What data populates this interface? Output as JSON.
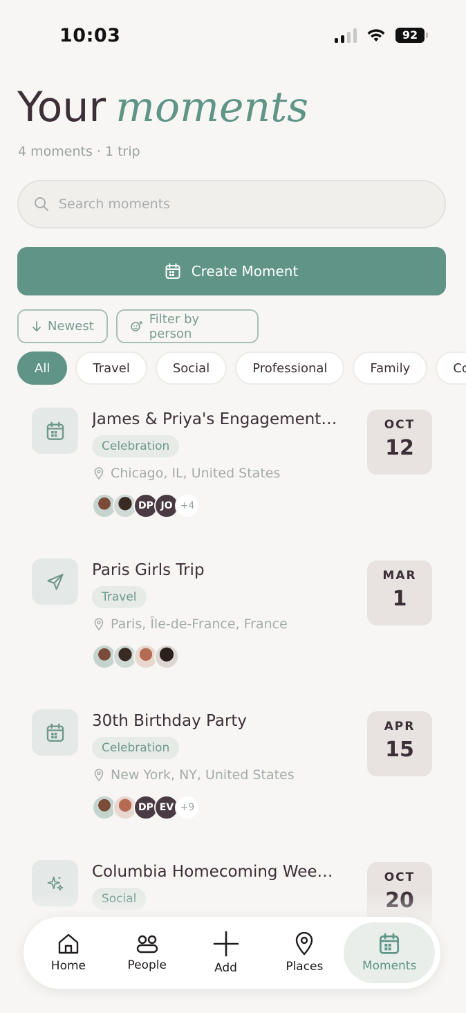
{
  "status_bar": {
    "time": "10:03",
    "battery": "92"
  },
  "header": {
    "title_plain": "Your",
    "title_accent": "moments",
    "subtitle": "4 moments · 1 trip"
  },
  "search": {
    "placeholder": "Search moments",
    "value": ""
  },
  "create_button": {
    "label": "Create Moment"
  },
  "sort": {
    "label": "Newest"
  },
  "filter": {
    "label": "Filter by person"
  },
  "categories": [
    "All",
    "Travel",
    "Social",
    "Professional",
    "Family",
    "Com"
  ],
  "moments": [
    {
      "title": "James & Priya's Engagement P...",
      "tag": "Celebration",
      "location": "Chicago, IL, United States",
      "month": "OCT",
      "day": "12",
      "icon": "calendar-icon",
      "avatars": [
        "photo",
        "photo",
        "DP",
        "JO"
      ],
      "more": "+4"
    },
    {
      "title": "Paris Girls Trip",
      "tag": "Travel",
      "location": "Paris, Île-de-France, France",
      "month": "MAR",
      "day": "1",
      "icon": "send-icon",
      "avatars": [
        "photo",
        "photo",
        "photo",
        "photo"
      ],
      "more": ""
    },
    {
      "title": "30th Birthday Party",
      "tag": "Celebration",
      "location": "New York, NY, United States",
      "month": "APR",
      "day": "15",
      "icon": "calendar-icon",
      "avatars": [
        "photo",
        "photo",
        "DP",
        "EV"
      ],
      "more": "+9"
    },
    {
      "title": "Columbia Homecoming Weeke...",
      "tag": "Social",
      "location": "",
      "month": "OCT",
      "day": "20",
      "icon": "sparkles-icon",
      "avatars": [],
      "more": ""
    }
  ],
  "nav": [
    {
      "label": "Home",
      "icon": "home-icon"
    },
    {
      "label": "People",
      "icon": "people-icon"
    },
    {
      "label": "Add",
      "icon": "plus-icon"
    },
    {
      "label": "Places",
      "icon": "map-pin-icon"
    },
    {
      "label": "Moments",
      "icon": "calendar-icon",
      "active": true
    }
  ],
  "colors": {
    "accent": "#5f9486",
    "text": "#3c2f37",
    "background": "#f7f6f4"
  }
}
